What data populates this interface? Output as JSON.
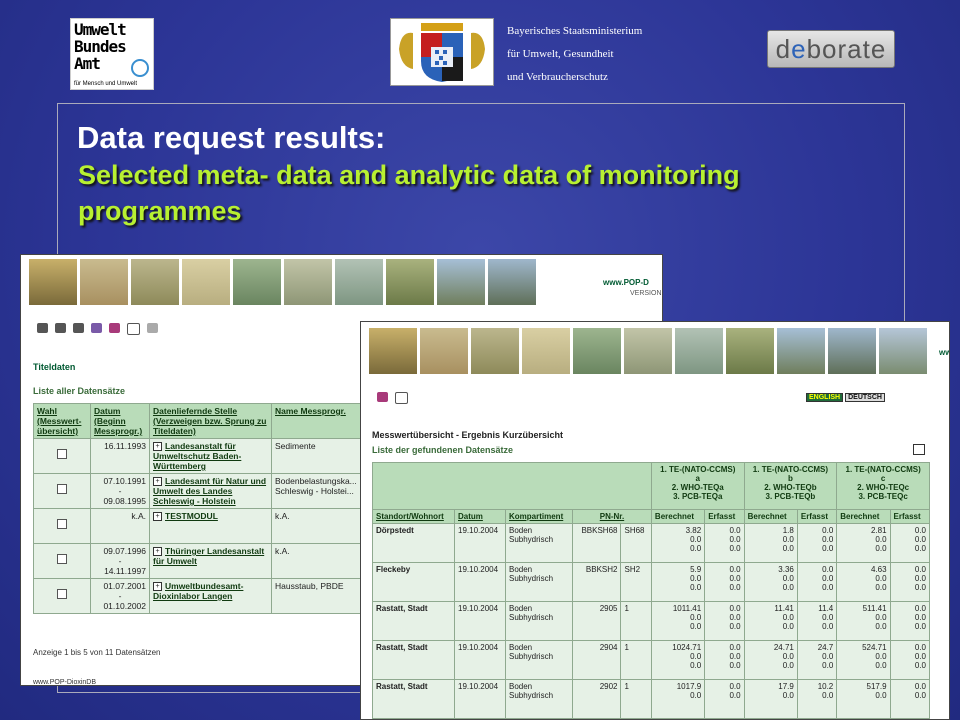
{
  "header": {
    "uba_logo_lines": [
      "Umwelt",
      "Bundes",
      "Amt"
    ],
    "uba_logo_sub": "für Mensch und Umwelt",
    "ministry_lines": [
      "Bayerisches Staatsministerium",
      "für Umwelt, Gesundheit",
      "und Verbraucherschutz"
    ],
    "deborate_logo": [
      "d",
      "e",
      "borate"
    ]
  },
  "slide": {
    "title": "Data request results:",
    "subtitle": "Selected meta- data and analytic data of monitoring programmes"
  },
  "shot1": {
    "site_url": "www.POP-D",
    "version": "VERSION",
    "toolbar_icons": [
      "binoculars-icon",
      "tools-icon",
      "chart-icon",
      "books-icon",
      "book-icon",
      "help-icon",
      "lock-icon"
    ],
    "section_title": "Titeldaten",
    "list_title": "Liste aller Datensätze",
    "columns": [
      "Wahl (Messwert-übersicht)",
      "Datum (Beginn Messprogr.)",
      "Datenliefernde Stelle (Verzweigen bzw. Sprung zu Titeldaten)",
      "Name Messprogr."
    ],
    "rows": [
      {
        "date": "16.11.1993",
        "date2": "",
        "org": "Landesanstalt für Umweltschutz Baden-Württemberg",
        "name": "Sedimente"
      },
      {
        "date": "07.10.1991",
        "date2": "09.08.1995",
        "org": "Landesamt für Natur und Umwelt des Landes Schleswig - Holstein",
        "name": "Bodenbelastungska... Schleswig - Holstei..."
      },
      {
        "date": "k.A.",
        "date2": "",
        "org": "TESTMODUL",
        "name": "k.A."
      },
      {
        "date": "09.07.1996",
        "date2": "14.11.1997",
        "org": "Thüringer Landesanstalt für Umwelt",
        "name": "k.A."
      },
      {
        "date": "01.07.2001",
        "date2": "01.10.2002",
        "org": "Umweltbundesamt-Dioxinlabor Langen",
        "name": "Hausstaub, PBDE"
      }
    ],
    "footer": "Anzeige 1 bis 5 von 11 Datensätzen",
    "status": "www.POP-DioxinDB"
  },
  "shot2": {
    "site_url": "ww",
    "lang_en": "ENGLISH",
    "lang_de": "DEUTSCH",
    "section_title": "Messwertübersicht - Ergebnis Kurzübersicht",
    "list_title": "Liste der gefundenen Datensätze",
    "groups": [
      [
        "1. TE-(NATO-CCMS)",
        "a",
        "2. WHO-TEQa",
        "3. PCB-TEQa"
      ],
      [
        "1. TE-(NATO-CCMS)",
        "b",
        "2. WHO-TEQb",
        "3. PCB-TEQb"
      ],
      [
        "1. TE-(NATO-CCMS)",
        "c",
        "2. WHO-TEQc",
        "3. PCB-TEQc"
      ]
    ],
    "columns": [
      "Standort/Wohnort",
      "Datum",
      "Kompartiment",
      "PN-Nr.",
      "",
      "Berechnet",
      "Erfasst",
      "Berechnet",
      "Erfasst",
      "Berechnet",
      "Erfasst"
    ],
    "rows": [
      {
        "loc": "Dörpstedt",
        "date": "19.10.2004",
        "komp": "Boden Subhydrisch",
        "pn": "BBKSH68",
        "pn2": "SH68",
        "vals": [
          [
            "3.82",
            "0.0",
            "0.0"
          ],
          [
            "0.0",
            "0.0",
            "0.0"
          ],
          [
            "1.8",
            "0.0",
            "0.0"
          ],
          [
            "0.0",
            "0.0",
            "0.0"
          ],
          [
            "2.81",
            "0.0",
            "0.0"
          ],
          [
            "0.0",
            "0.0",
            "0.0"
          ]
        ]
      },
      {
        "loc": "Fleckeby",
        "date": "19.10.2004",
        "komp": "Boden Subhydrisch",
        "pn": "BBKSH2",
        "pn2": "SH2",
        "vals": [
          [
            "5.9",
            "0.0",
            "0.0"
          ],
          [
            "0.0",
            "0.0",
            "0.0"
          ],
          [
            "3.36",
            "0.0",
            "0.0"
          ],
          [
            "0.0",
            "0.0",
            "0.0"
          ],
          [
            "4.63",
            "0.0",
            "0.0"
          ],
          [
            "0.0",
            "0.0",
            "0.0"
          ]
        ]
      },
      {
        "loc": "Rastatt, Stadt",
        "date": "19.10.2004",
        "komp": "Boden Subhydrisch",
        "pn": "2905",
        "pn2": "1",
        "vals": [
          [
            "1011.41",
            "0.0",
            "0.0"
          ],
          [
            "0.0",
            "0.0",
            "0.0"
          ],
          [
            "11.41",
            "0.0",
            "0.0"
          ],
          [
            "11.4",
            "0.0",
            "0.0"
          ],
          [
            "511.41",
            "0.0",
            "0.0"
          ],
          [
            "0.0",
            "0.0",
            "0.0"
          ]
        ]
      },
      {
        "loc": "Rastatt, Stadt",
        "date": "19.10.2004",
        "komp": "Boden Subhydrisch",
        "pn": "2904",
        "pn2": "1",
        "vals": [
          [
            "1024.71",
            "0.0",
            "0.0"
          ],
          [
            "0.0",
            "0.0",
            "0.0"
          ],
          [
            "24.71",
            "0.0",
            "0.0"
          ],
          [
            "24.7",
            "0.0",
            "0.0"
          ],
          [
            "524.71",
            "0.0",
            "0.0"
          ],
          [
            "0.0",
            "0.0",
            "0.0"
          ]
        ]
      },
      {
        "loc": "Rastatt, Stadt",
        "date": "19.10.2004",
        "komp": "Boden Subhydrisch",
        "pn": "2902",
        "pn2": "1",
        "vals": [
          [
            "1017.9",
            "0.0",
            ""
          ],
          [
            "0.0",
            "0.0",
            ""
          ],
          [
            "17.9",
            "0.0",
            ""
          ],
          [
            "10.2",
            "0.0",
            ""
          ],
          [
            "517.9",
            "0.0",
            ""
          ],
          [
            "0.0",
            "0.0",
            ""
          ]
        ]
      }
    ]
  },
  "colors": {
    "slide_bg": "#2c3596",
    "subtitle": "#b8f031",
    "table_header": "#b9dcb9",
    "table_cell": "#e6f1e6",
    "section_green": "#005a32"
  }
}
